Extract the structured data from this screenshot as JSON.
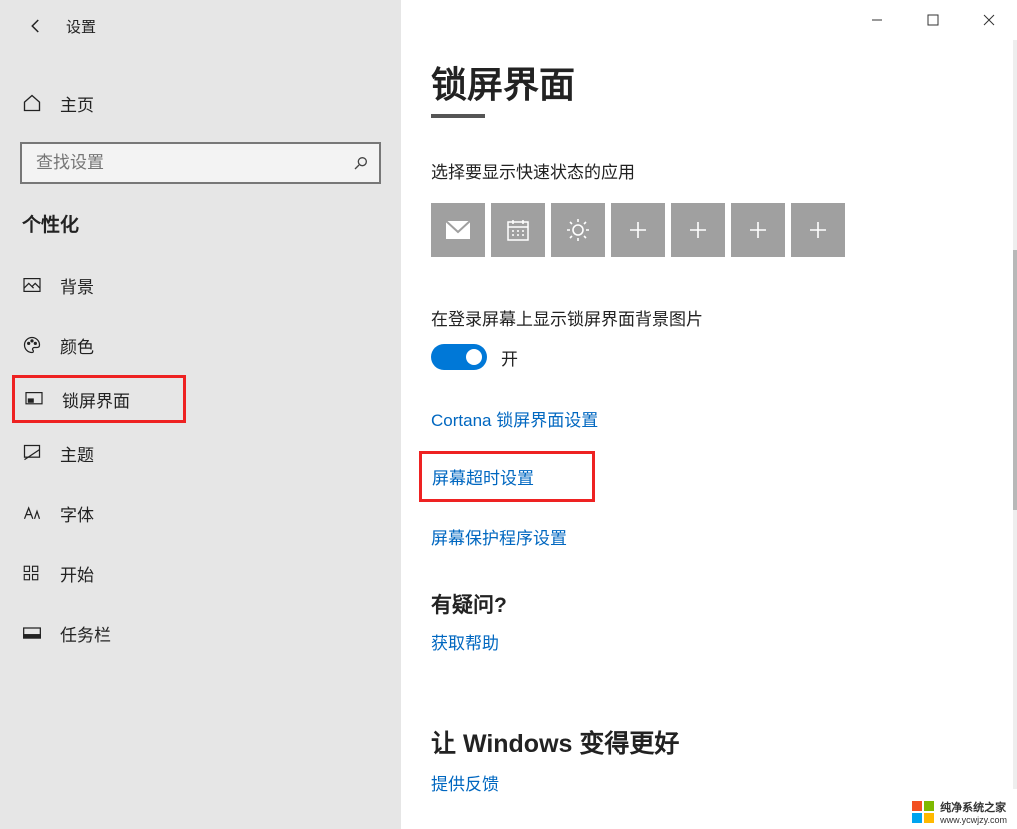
{
  "window": {
    "title": "设置"
  },
  "sidebar": {
    "home": "主页",
    "search_placeholder": "查找设置",
    "category": "个性化",
    "items": [
      {
        "label": "背景"
      },
      {
        "label": "颜色"
      },
      {
        "label": "锁屏界面"
      },
      {
        "label": "主题"
      },
      {
        "label": "字体"
      },
      {
        "label": "开始"
      },
      {
        "label": "任务栏"
      }
    ]
  },
  "main": {
    "title": "锁屏界面",
    "quick_status_label": "选择要显示快速状态的应用",
    "toggle_label": "在登录屏幕上显示锁屏界面背景图片",
    "toggle_state": "开",
    "links": {
      "cortana": "Cortana 锁屏界面设置",
      "timeout": "屏幕超时设置",
      "screensaver": "屏幕保护程序设置"
    },
    "question_heading": "有疑问?",
    "get_help": "获取帮助",
    "improve_heading": "让 Windows 变得更好",
    "feedback": "提供反馈"
  },
  "watermark": {
    "line1": "纯净系统之家",
    "line2": "www.ycwjzy.com"
  }
}
